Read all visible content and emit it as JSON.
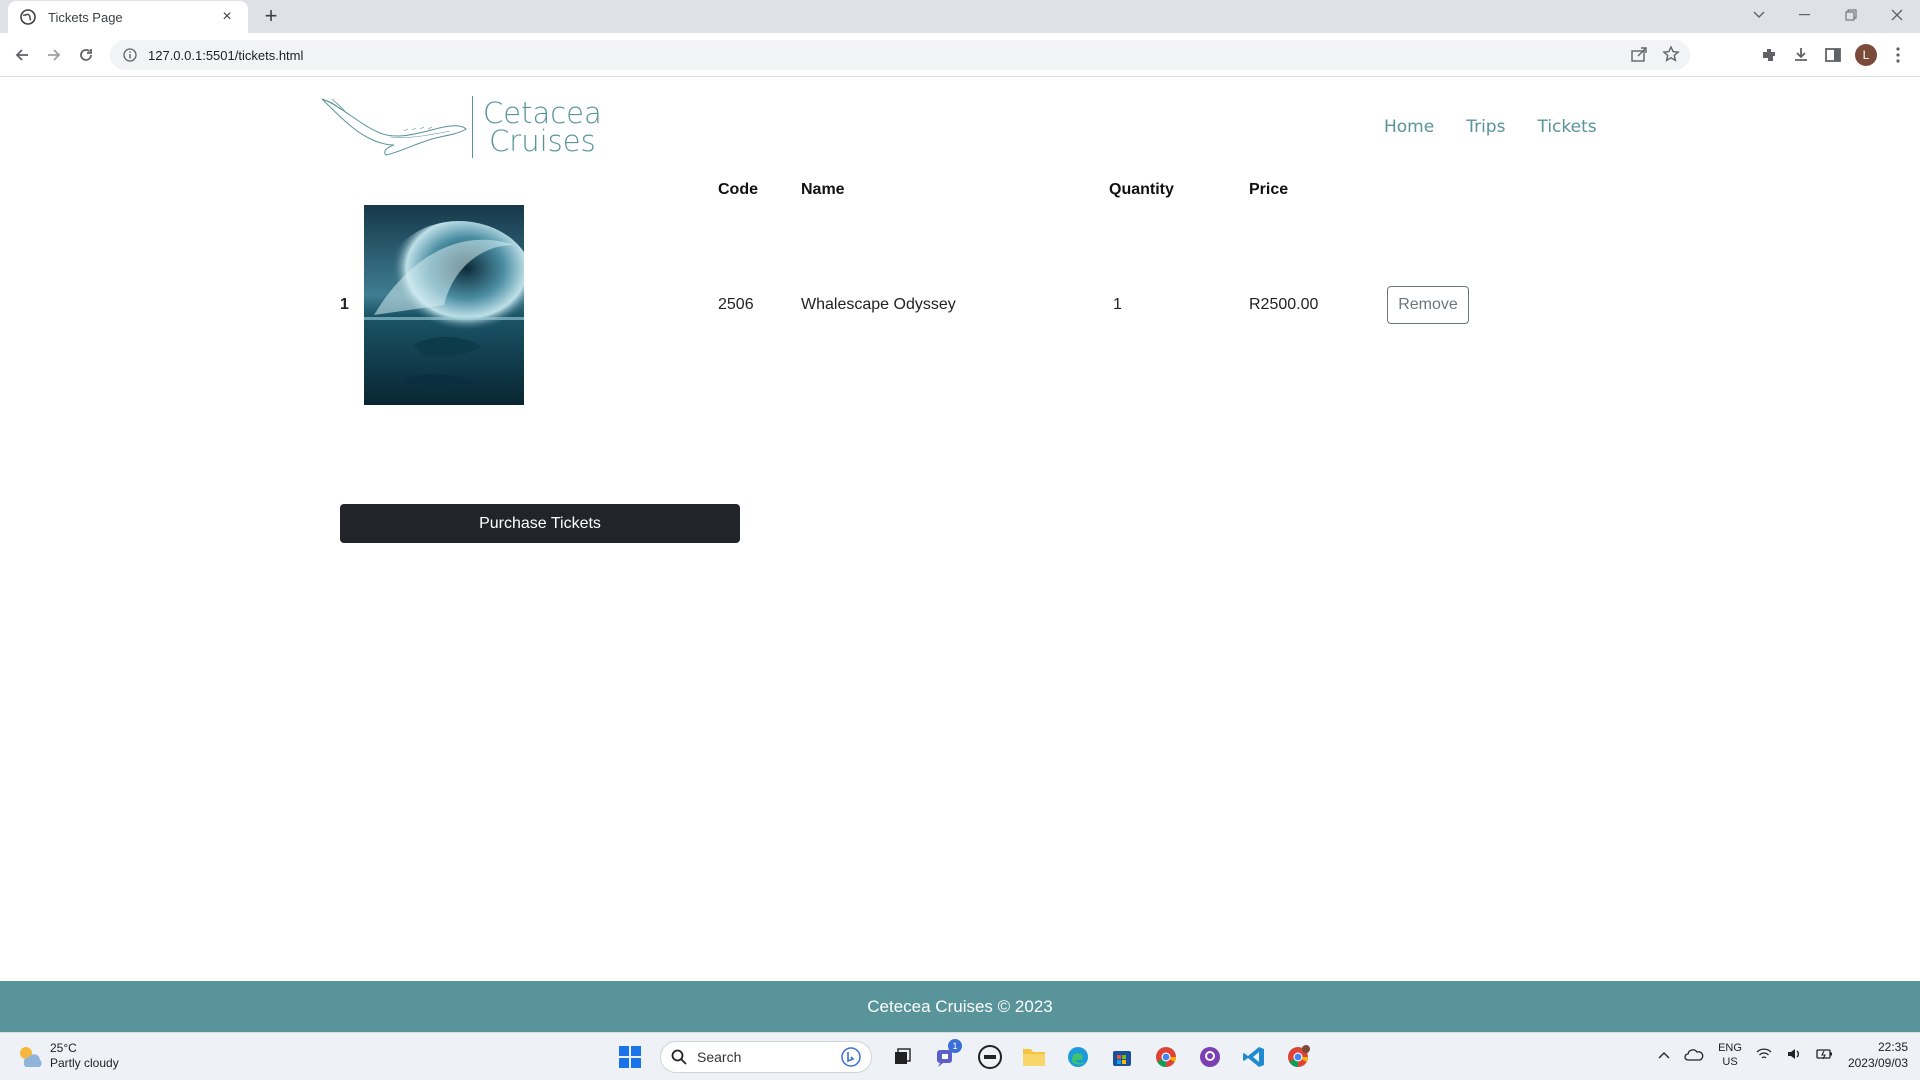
{
  "browser": {
    "tab_title": "Tickets Page",
    "url": "127.0.0.1:5501/tickets.html",
    "profile_initial": "L"
  },
  "site": {
    "logo_line1": "Cetacea",
    "logo_line2": "Cruises",
    "nav": [
      "Home",
      "Trips",
      "Tickets"
    ],
    "brand_color": "#58949a"
  },
  "table": {
    "headers": {
      "code": "Code",
      "name": "Name",
      "quantity": "Quantity",
      "price": "Price"
    },
    "rows": [
      {
        "index": "1",
        "code": "2506",
        "name": "Whalescape Odyssey",
        "quantity": "1",
        "price": "R2500.00",
        "action": "Remove"
      }
    ]
  },
  "purchase_label": "Purchase Tickets",
  "footer_text": "Cetecea Cruises © 2023",
  "taskbar": {
    "temperature": "25°C",
    "condition": "Partly cloudy",
    "search_placeholder": "Search",
    "chat_badge": "1",
    "lang_line1": "ENG",
    "lang_line2": "US",
    "time": "22:35",
    "date": "2023/09/03"
  }
}
